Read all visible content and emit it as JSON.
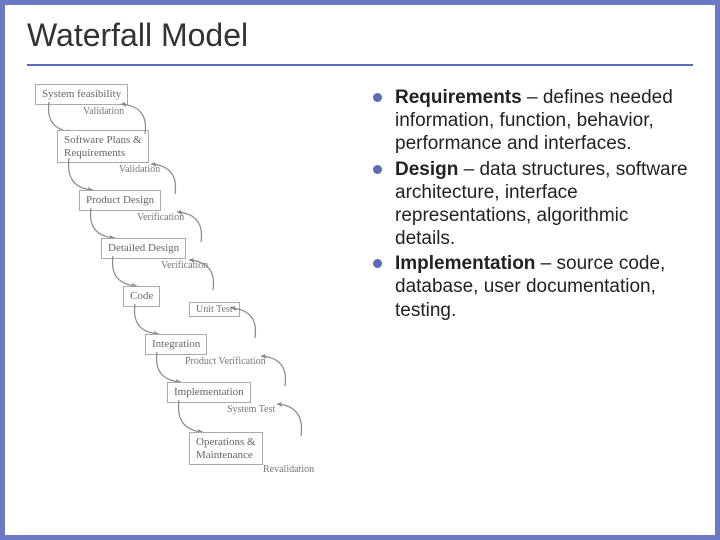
{
  "title": "Waterfall Model",
  "diagram": {
    "stages": [
      {
        "label": "System feasibility",
        "sub": "Validation"
      },
      {
        "label": "Software Plans &\nRequirements",
        "sub": "Validation"
      },
      {
        "label": "Product Design",
        "sub": "Verification"
      },
      {
        "label": "Detailed Design",
        "sub": "Verification"
      },
      {
        "label": "Code",
        "sub": "Unit Test"
      },
      {
        "label": "Integration",
        "sub": "Product Verification"
      },
      {
        "label": "Implementation",
        "sub": "System Test"
      },
      {
        "label": "Operations &\nMaintenance",
        "sub": "Revalidation"
      }
    ]
  },
  "bullets": [
    {
      "term": "Requirements",
      "desc": " – defines needed information, function, behavior, performance and interfaces."
    },
    {
      "term": "Design",
      "desc": " – data structures, software architecture, interface representations, algorithmic details."
    },
    {
      "term": "Implementation",
      "desc": " – source code, database, user documentation, testing."
    }
  ]
}
